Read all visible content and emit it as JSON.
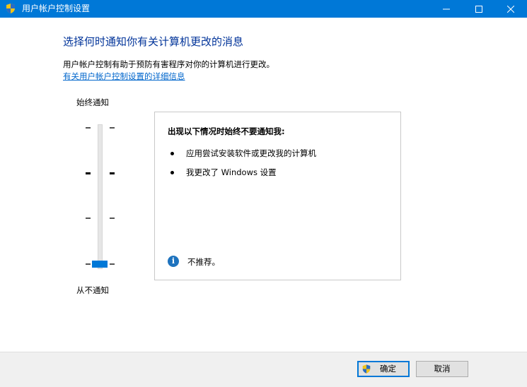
{
  "window": {
    "title": "用户帐户控制设置"
  },
  "main": {
    "heading": "选择何时通知你有关计算机更改的消息",
    "description": "用户帐户控制有助于预防有害程序对你的计算机进行更改。",
    "link": "有关用户帐户控制设置的详细信息"
  },
  "slider": {
    "top_label": "始终通知",
    "bottom_label": "从不通知",
    "level": 1,
    "levels": 4
  },
  "infobox": {
    "title": "出现以下情况时始终不要通知我:",
    "bullets": [
      "应用尝试安装软件或更改我的计算机",
      "我更改了 Windows 设置"
    ],
    "recommendation": "不推荐。",
    "info_icon": "info-icon"
  },
  "footer": {
    "ok_label": "确定",
    "cancel_label": "取消"
  },
  "colors": {
    "accent": "#0078d7",
    "heading": "#003399",
    "link": "#0066cc"
  }
}
